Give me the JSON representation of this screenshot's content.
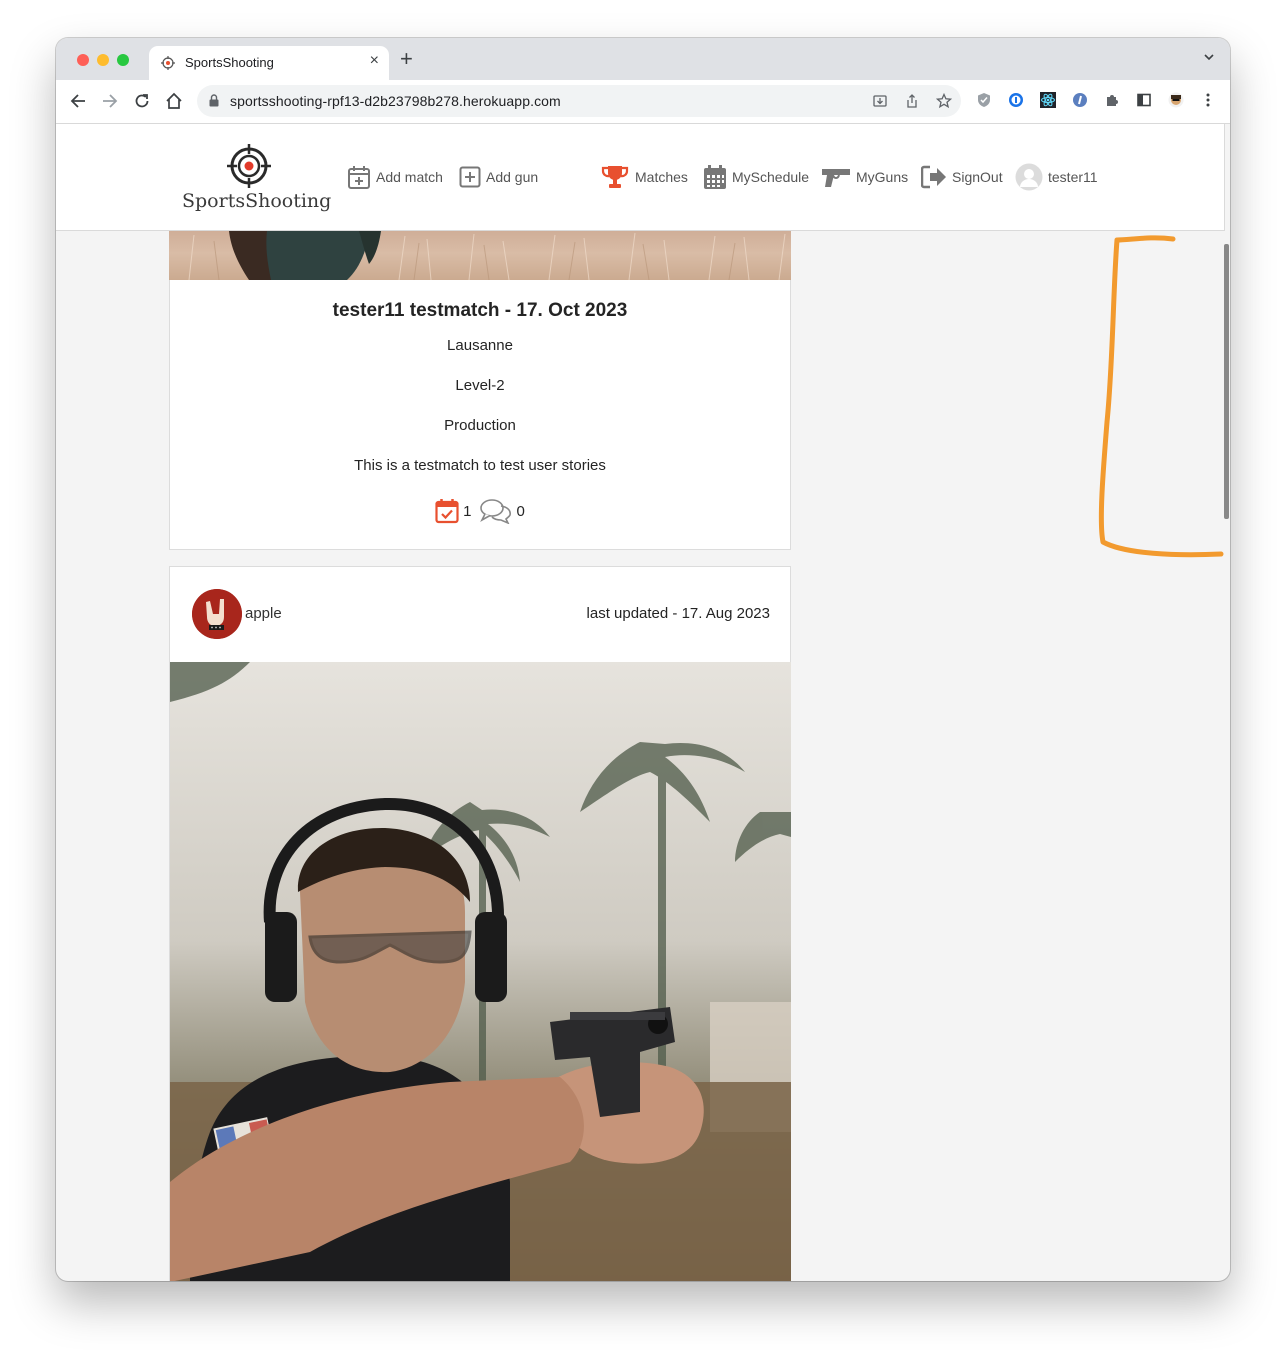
{
  "browser": {
    "tab_title": "SportsShooting",
    "tab_close": "×",
    "new_tab": "+",
    "url": "sportsshooting-rpf13-d2b23798b278.herokuapp.com"
  },
  "site": {
    "brand": "SportsShooting",
    "nav": {
      "add_match": "Add match",
      "add_gun": "Add gun",
      "matches": "Matches",
      "myschedule": "MySchedule",
      "myguns": "MyGuns",
      "signout": "SignOut",
      "user": "tester11"
    }
  },
  "match_card": {
    "title": "tester11 testmatch - 17. Oct 2023",
    "location": "Lausanne",
    "level": "Level-2",
    "division": "Production",
    "description": "This is a testmatch to test user stories",
    "schedule_count": "1",
    "comment_count": "0"
  },
  "post_card": {
    "owner": "apple",
    "updated": "last updated - 17. Aug 2023"
  },
  "colors": {
    "accent": "#e8502f",
    "annotation": "#f29a2e",
    "nav_text": "#555555"
  }
}
